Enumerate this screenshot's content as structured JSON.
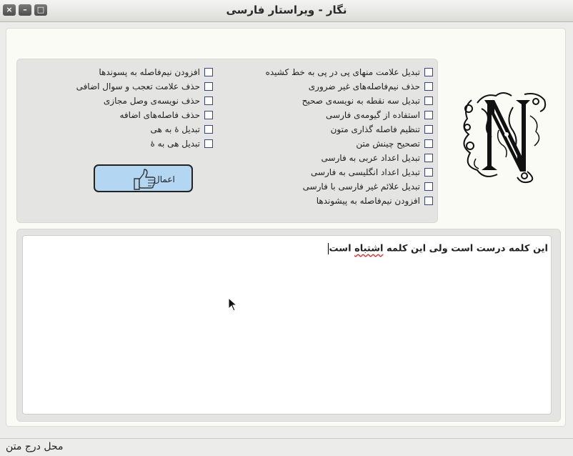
{
  "window": {
    "title": "نگار - ویراستار فارسی",
    "buttons": [
      "×",
      "–",
      "□"
    ]
  },
  "options_right": [
    "تبدیل علامت منهای پی در پی به خط کشیده",
    "حذف نیم‌فاصله‌های غیر ضروری",
    "تبدیل سه نقطه به نویسه‌ی صحیح",
    "استفاده از گیومه‌ی فارسی",
    "تنظیم فاصله گذاری متون",
    "تصحیح چینش متن",
    "تبدیل اعداد عربی به فارسی",
    "تبدیل اعداد انگلیسی به فارسی",
    "تبدیل علائم غیر فارسی با فارسی",
    "افزودن نیم‌فاصله به پیشوندها"
  ],
  "options_left": [
    "افزودن نیم‌فاصله به پسوندها",
    "حذف علامت تعجب و سوال اضافی",
    "حذف نویسه‌ی وصل مجازی",
    "حذف فاصله‌های اضافه",
    "تبدیل هٔ به هی",
    "تبدیل هی به هٔ"
  ],
  "apply_button": {
    "label": "اعمال"
  },
  "editor": {
    "text_before": "این کلمه درست است ولی این کلمه ",
    "misspelled": "اشتباه",
    "text_after": " است"
  },
  "status": "محل درج متن",
  "colors": {
    "accent_button": "#b3d7f2",
    "checkbox_border": "#39457a",
    "spell_error": "#d22222"
  },
  "icons": {
    "apply": "thumbs-up-icon",
    "logo": "ornamental-N-logo"
  }
}
